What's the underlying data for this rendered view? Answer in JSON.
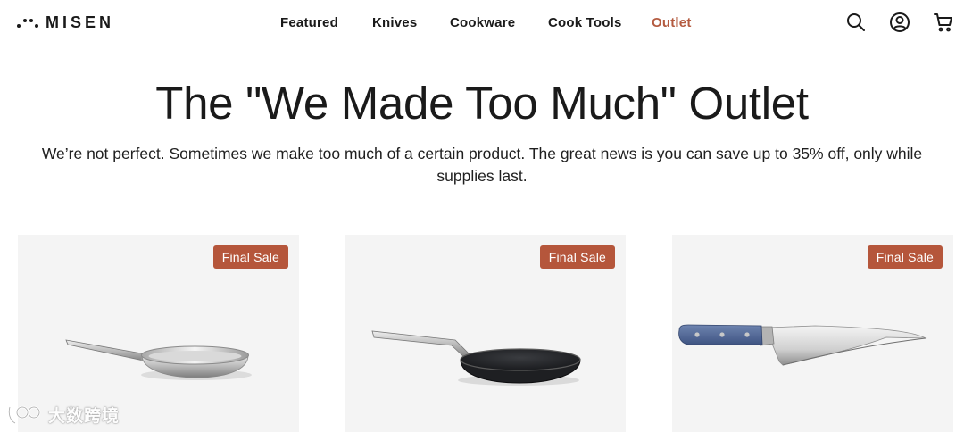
{
  "brand": {
    "name": "MISEN"
  },
  "nav": {
    "items": [
      {
        "label": "Featured"
      },
      {
        "label": "Knives"
      },
      {
        "label": "Cookware"
      },
      {
        "label": "Cook Tools"
      },
      {
        "label": "Outlet",
        "active": true
      }
    ],
    "active_color": "#b45b40"
  },
  "header_icons": [
    "search-icon",
    "account-icon",
    "cart-icon"
  ],
  "hero": {
    "title": "The \"We Made Too Much\" Outlet",
    "subtitle": "We’re not perfect. Sometimes we make too much of a certain product. The great news is you can save up to 35% off, only while supplies last."
  },
  "products": [
    {
      "badge": "Final Sale",
      "image": "stainless-skillet"
    },
    {
      "badge": "Final Sale",
      "image": "nonstick-skillet"
    },
    {
      "badge": "Final Sale",
      "image": "chef-knife-blue-handle"
    }
  ],
  "colors": {
    "badge": "#b5563b",
    "card_bg": "#f4f4f4",
    "text": "#1a1a1a"
  },
  "watermark": {
    "text": "大数跨境",
    "logo": "watermark-logo"
  }
}
